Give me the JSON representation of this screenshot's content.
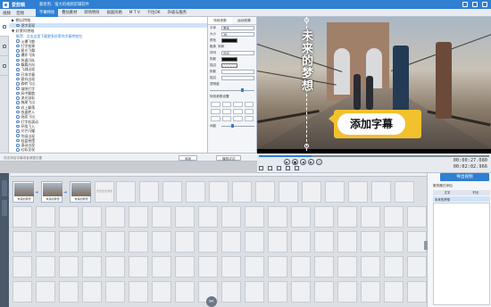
{
  "app": {
    "name": "爱剪辑",
    "subtitle": "最易用、强大的视频剪辑软件"
  },
  "menu": [
    "视频",
    "音频"
  ],
  "tabs": [
    {
      "label": "字幕特效",
      "active": true
    },
    {
      "label": "叠加素材",
      "active": false
    },
    {
      "label": "转场特效",
      "active": false
    },
    {
      "label": "画面风格",
      "active": false
    },
    {
      "label": "M T V",
      "active": false
    },
    {
      "label": "卡拉OK",
      "active": false
    },
    {
      "label": "升级与服务",
      "active": false
    }
  ],
  "effects": {
    "groups": [
      {
        "label": "▶ 想以特效",
        "items": [
          "逐字显现"
        ]
      },
      {
        "label": "▼ 好莱坞特效",
        "link": "推荐：点击这里下载更多好莱坞字幕特效包",
        "items": [
          "火爆飞散",
          "打字效果",
          "星光飞舞",
          "爆炸飞扬",
          "快速闪烁",
          "飘舞方向",
          "飞溅出现",
          "开场字幕",
          "颤抖出现",
          "旋转飞出",
          "渐隐打字",
          "风中飘散",
          "流光溢彩",
          "拖尾飞出",
          "向上飘落",
          "快速转入",
          "画面飞出",
          "打字机滚动",
          "环绕飞入",
          "光芒闪耀",
          "华丽出现",
          "轻盈摇摆",
          "滚动出现",
          "幻彩呈现",
          "流星飞逝",
          "水波荡漾",
          "雨滴飞舞",
          "炫光字幕"
        ]
      }
    ],
    "selected": "逐字显现"
  },
  "props": {
    "tabs": [
      "特效参数",
      "运动效果"
    ],
    "font_label": "字体",
    "font_value": "黑体",
    "size_label": "大小",
    "size_value": "36",
    "color_label": "颜色",
    "bold_label": "粗体",
    "italic_label": "斜体",
    "align_label": "排列",
    "align_value": "自动",
    "shadow_label": "阴影",
    "stroke_label": "描边",
    "opacity_label": "透明度",
    "spacing_label": "间距",
    "style_label": "特效参数设置",
    "checkbox": "阴影",
    "checkbox2": "描边"
  },
  "preview": {
    "caption": "未来的梦想",
    "callout": "添加字幕",
    "time_current": "00:00:27.080",
    "time_total": "00:02:02.966",
    "progress": 0.23
  },
  "hintbar": {
    "hint": "双击添加字幕或者调整位置",
    "add_button": "添加",
    "preview_button": "播放试试"
  },
  "timeline": {
    "clips": [
      {
        "name": "未来的梦想"
      },
      {
        "name": "未来的梦想"
      },
      {
        "name": "未来的梦想"
      }
    ],
    "drop_hint": "双击此处添加"
  },
  "right": {
    "export_label": "导出视频",
    "header": "服务器已添加",
    "col1": "文字",
    "col2": "时长",
    "row1": "未来的梦想"
  },
  "colors": {
    "accent": "#2f7fd3",
    "callout": "#f2c12e"
  }
}
